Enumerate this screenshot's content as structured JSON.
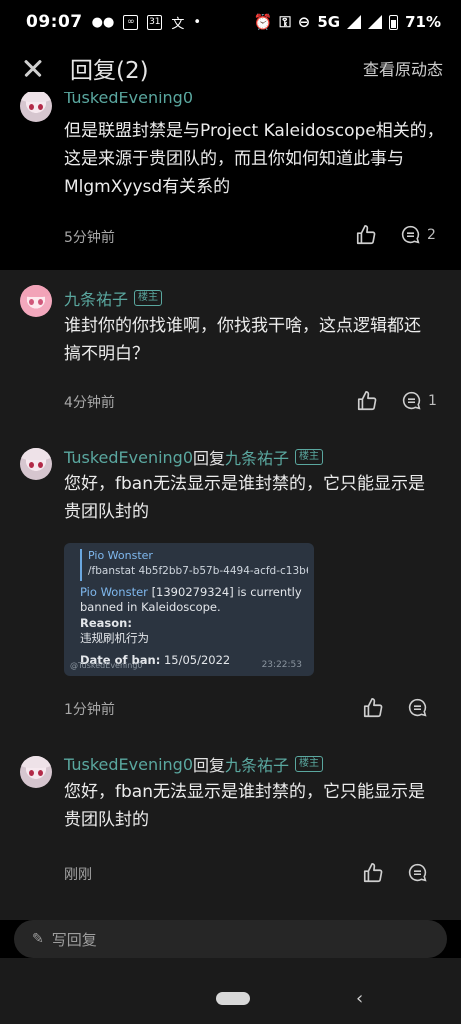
{
  "status_bar": {
    "time": "09:07",
    "network": "5G",
    "battery": "71%"
  },
  "header": {
    "title": "回复(2)",
    "view_original": "查看原动态"
  },
  "thread": [
    {
      "user": "TuskedEvening0",
      "text_lines": [
        "但是联盟封禁是与Project Kaleidoscope相关的，",
        "这是来源于贵团队的，而且你如何知道此事与",
        "MlgmXyysd有关系的"
      ],
      "time": "5分钟前",
      "comments": "2"
    },
    {
      "user": "九条祐子",
      "badge": "楼主",
      "text_lines": [
        "谁封你的你找谁啊，你找我干啥，这点逻辑都还",
        "搞不明白？"
      ],
      "time": "4分钟前",
      "comments": "1"
    },
    {
      "user": "TuskedEvening0",
      "reply_word": "回复",
      "reply_to": "九条祐子",
      "badge": "楼主",
      "text_lines": [
        "您好，fban无法显示是谁封禁的，它只能显示是",
        "贵团队封的"
      ],
      "time": "1分钟前",
      "embed": {
        "quote_name": "Pio Wonster",
        "quote_text": "/fbanstat 4b5f2bb7-b57b-4494-acfd-c13b6a...",
        "name": "Pio Wonster",
        "line1_rest": "[1390279324] is currently",
        "line2": "banned in Kaleidoscope.",
        "reason_label": "Reason:",
        "reason_value": "违规刷机行为",
        "date_label": "Date of ban:",
        "date_value": "15/05/2022",
        "msg_time": "23:22:53",
        "watermark": "@TuskedEvening0"
      }
    },
    {
      "user": "TuskedEvening0",
      "reply_word": "回复",
      "reply_to": "九条祐子",
      "badge": "楼主",
      "text_lines": [
        "您好，fban无法显示是谁封禁的，它只能显示是",
        "贵团队封的"
      ],
      "time": "刚刚"
    }
  ],
  "input": {
    "placeholder": "写回复"
  }
}
